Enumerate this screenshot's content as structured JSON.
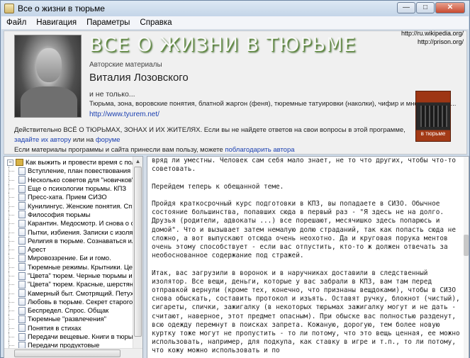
{
  "window": {
    "title": "Все о жизни в тюрьме"
  },
  "menu": [
    "Файл",
    "Навигация",
    "Параметры",
    "Справка"
  ],
  "header": {
    "title": "ВСЕ О ЖИЗНИ В ТЮРЬМЕ",
    "subtitle": "Авторские материалы",
    "author": "Виталия Лозовского",
    "not_only": "и не только...",
    "topics": "Тюрьма, зона, воровские понятия, блатной жаргон (феня), тюремные татуировки (наколки), чифир и многое другое...",
    "site_link": "http://www.tyurem.net/",
    "ext_links": [
      "http://ru.wikipedia.org/",
      "http://prison.org/"
    ],
    "book_title": "в тюрьме",
    "info": {
      "line1": "Действительно ВСЁ О ТЮРЬМАХ, ЗОНАХ И ИХ ЖИТЕЛЯХ. Если вы не найдете ответов на свои вопросы в этой программе,",
      "ask_author": "задайте их автору",
      "or_on": " или на ",
      "forum": "форуме",
      "line3": "Если материалы программы и сайта принесли вам пользу, можете ",
      "thank_author": "поблагодарить автора"
    }
  },
  "tree": {
    "root": "Как выжить и провести время с пользой",
    "items": [
      "Вступление, план повествования",
      "Несколько советов для \"новичков\".",
      "Еще о психологии тюрьмы. КПЗ",
      "Пресс-хата. Прием СИЗО",
      "Кунилингус. Женские понятия. Спра",
      "Философия тюрьмы",
      "Карантин. Медосмотр. И снова о сту",
      "Пытки, избиения. Записки с изолятор",
      "Религия в тюрьме. Сознаваться или",
      "Арест",
      "Мировоззрение. Би и гомо.",
      "Тюремные режимы. Крытники. Центр",
      "\"Цвета\" тюрем. Черные тюрьмы и зо",
      "\"Цвета\" тюрем. Красные, шерстяные",
      "Камерный быт. Смотрящий. Петух.",
      "Любовь в тюрьме. Секрет старого ка",
      "Беспредел. Спрос. Общак",
      "Тюремные \"развлечения\"",
      "Понятия в стихах",
      "Передачи вещевые. Книги в тюрьме",
      "Передачи продуктовые",
      "\"Сеанс\" - чай и сигареты"
    ]
  },
  "article": [
    "вряд ли уместны. Человек сам себя мало знает, не то что других, чтобы что-то советовать.",
    "Перейдем теперь к обещанной теме.",
    "Пройдя краткосрочный курс подготовки в КПЗ, вы попадаете в СИЗО. Обычное состояние большинства, попавших сюда в первый раз - \"Я здесь не на долго. Друзья (родители, адвокаты ...) все порешают, месячишко здесь попарюсь и домой\". Что и вызывает затем немалую долю страданий, так как попасть сюда не сложно, а вот выпускают отсюда очень неохотно. Да и круговая порука ментов очень этому способствует - если вас отпустить, кто-то ж должен отвечать за необоснованное содержание под стражей.",
    "Итак, вас загрузили в воронок и в наручниках доставили в следственный изолятор. Все вещи, деньги, которые у вас забрали в КПЗ, вам там перед отправкой вернули (кроме тех, конечно, что признаны вещдоками), чтобы в СИЗО снова обыскать, составить протокол и изъять. Оставят ручку, блокнот (чистый), сигареты, спички, зажигалку (в некоторых тюрьмах зажигалку могут и не дать - считают, наверное, этот предмет опасным). При обыске вас полностью разденут, всю одежду перемнут в поисках запрета. Кожаную, дорогую, тем более новую куртку тоже могут не пропустить - то ли потому, что это вещь ценная, ее можно использовать, например, для подкупа, как ставку в игре и т.п., то ли потому, что кожу можно использовать и по"
  ],
  "colors": {
    "title_shadow": "#355e1f",
    "link": "#1a3fb0",
    "book": "#9e3614"
  }
}
